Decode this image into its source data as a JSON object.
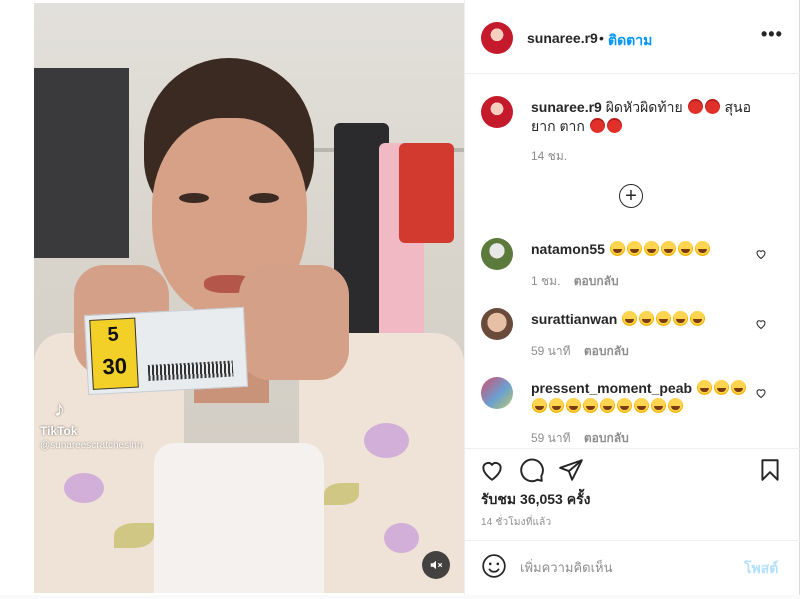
{
  "post": {
    "username": "sunaree.r9",
    "separator": "•",
    "follow_label": "ติดตาม",
    "more_label": "•••",
    "caption_username": "sunaree.r9",
    "caption_text_1": "ผิดหัวผิดท้าย",
    "caption_text_2": "สุนอยาก",
    "caption_text_3": "ตาก",
    "caption_time": "14 ชม.",
    "load_more_label": "+"
  },
  "media": {
    "ticket_top_number": "5",
    "ticket_bottom_number": "30",
    "watermark_brand": "TikTok",
    "watermark_handle": "@sunareescratchesinn",
    "mute_icon": "speaker-muted-icon"
  },
  "comments": [
    {
      "username": "natamon55",
      "time": "1 ชม.",
      "reply_label": "ตอบกลับ"
    },
    {
      "username": "surattianwan",
      "time": "59 นาที",
      "reply_label": "ตอบกลับ"
    },
    {
      "username": "pressent_moment_peab",
      "time": "59 นาที",
      "reply_label": "ตอบกลับ"
    }
  ],
  "stats": {
    "views_label": "รับชม 36,053 ครั้ง",
    "posted_ago": "14 ชั่วโมงที่แล้ว"
  },
  "comment_box": {
    "placeholder": "เพิ่มความคิดเห็น",
    "post_label": "โพสต์"
  },
  "colors": {
    "accent": "#0095f6",
    "post_disabled": "#b2dffc",
    "secondary_text": "#8e8e8e"
  }
}
